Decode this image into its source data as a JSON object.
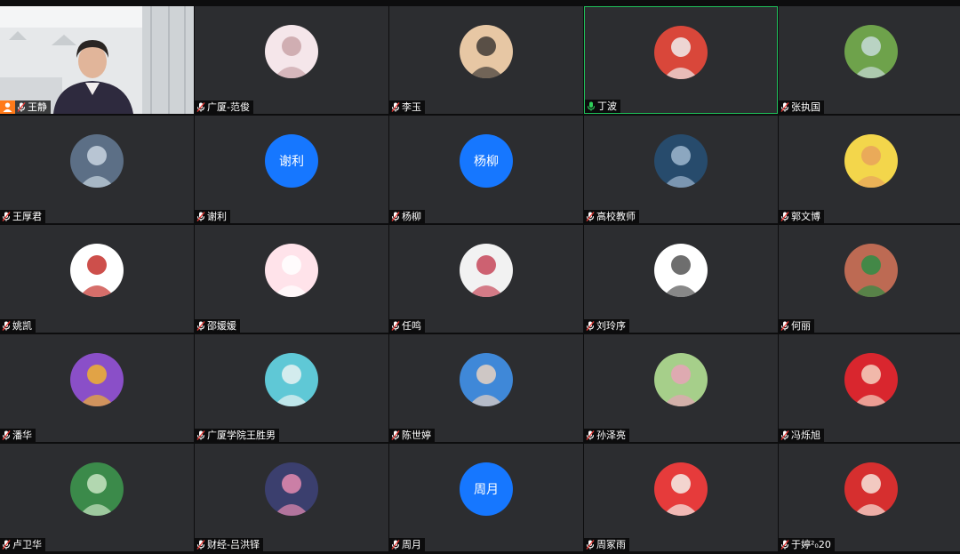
{
  "participants": [
    {
      "name": "王静",
      "kind": "video",
      "host": true
    },
    {
      "name": "广厦-范俊",
      "kind": "photo",
      "a": "#f5e6ea",
      "b": "#c9a3a8"
    },
    {
      "name": "李玉",
      "kind": "photo",
      "a": "#e7c7a4",
      "b": "#3f3a36"
    },
    {
      "name": "丁波",
      "kind": "photo",
      "a": "#d9473a",
      "b": "#f0eeee",
      "speaking": true
    },
    {
      "name": "张执国",
      "kind": "photo",
      "a": "#6ea24b",
      "b": "#c7dcd8"
    },
    {
      "name": "王厚君",
      "kind": "photo",
      "a": "#5c6f86",
      "b": "#c8d5e0"
    },
    {
      "name": "谢利",
      "kind": "text",
      "label": "谢利"
    },
    {
      "name": "杨柳",
      "kind": "text",
      "label": "杨柳"
    },
    {
      "name": "高校教师",
      "kind": "photo",
      "a": "#274b6c",
      "b": "#9fb7cf"
    },
    {
      "name": "郭文博",
      "kind": "photo",
      "a": "#f3d64b",
      "b": "#e7a25c"
    },
    {
      "name": "姚凯",
      "kind": "photo",
      "a": "#ffffff",
      "b": "#c4302b"
    },
    {
      "name": "邵媛媛",
      "kind": "photo",
      "a": "#ffe3ea",
      "b": "#ffffff"
    },
    {
      "name": "任鸣",
      "kind": "photo",
      "a": "#f2f2f2",
      "b": "#c7485a"
    },
    {
      "name": "刘玲序",
      "kind": "photo",
      "a": "#ffffff",
      "b": "#555555"
    },
    {
      "name": "何丽",
      "kind": "photo",
      "a": "#bd6a53",
      "b": "#2e8d45"
    },
    {
      "name": "潘华",
      "kind": "photo",
      "a": "#8a4fc8",
      "b": "#f0b12f"
    },
    {
      "name": "广厦学院王胜男",
      "kind": "photo",
      "a": "#5fc8d6",
      "b": "#e8f2f2"
    },
    {
      "name": "陈世婷",
      "kind": "photo",
      "a": "#3f88d8",
      "b": "#e8d2c2"
    },
    {
      "name": "孙泽亮",
      "kind": "photo",
      "a": "#a6cf8a",
      "b": "#e7a3b7"
    },
    {
      "name": "冯烁旭",
      "kind": "photo",
      "a": "#d9262e",
      "b": "#f4d2c0"
    },
    {
      "name": "卢卫华",
      "kind": "photo",
      "a": "#3b8a4a",
      "b": "#c8e4c2"
    },
    {
      "name": "财经-吕洪铎",
      "kind": "photo",
      "a": "#3b3f6e",
      "b": "#e58bb0"
    },
    {
      "name": "周月",
      "kind": "text",
      "label": "周月"
    },
    {
      "name": "周冢雨",
      "kind": "photo",
      "a": "#e63b3b",
      "b": "#f5f0ea"
    },
    {
      "name": "于婷²₀20",
      "kind": "photo",
      "a": "#d62f2f",
      "b": "#f7e4da"
    }
  ],
  "colors": {
    "text_avatar": "#1677ff",
    "speaking_border": "#20c05a",
    "host_badge": "#ff7a1a"
  }
}
